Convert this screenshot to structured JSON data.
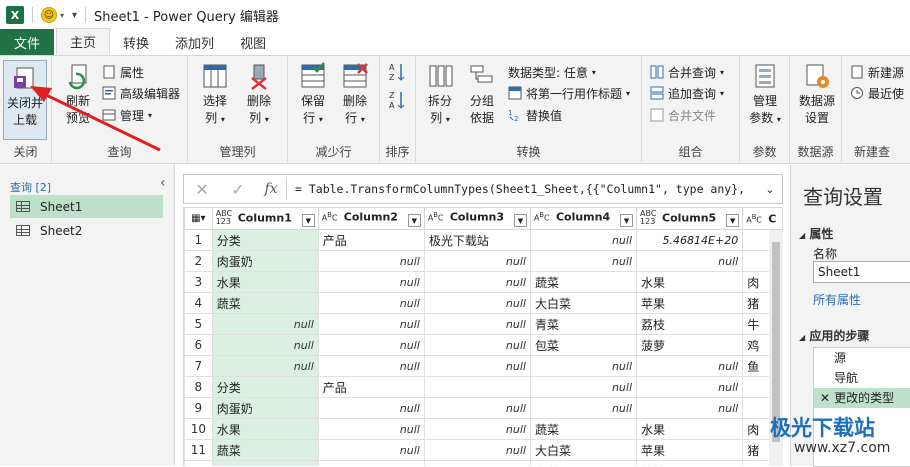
{
  "titlebar": {
    "title": "Sheet1 - Power Query 编辑器",
    "logo": "X"
  },
  "tabs": [
    "文件",
    "主页",
    "转换",
    "添加列",
    "视图"
  ],
  "ribbon": {
    "close": {
      "label1": "关闭并",
      "label2": "上载",
      "group": "关闭"
    },
    "query": {
      "refresh1": "刷新",
      "refresh2": "预览",
      "properties": "属性",
      "advanced": "高级编辑器",
      "manage": "管理",
      "group": "查询"
    },
    "columns": {
      "select1": "选择",
      "select2": "列",
      "delete1": "删除",
      "delete2": "列",
      "group": "管理列"
    },
    "rows": {
      "keep1": "保留",
      "keep2": "行",
      "remove1": "删除",
      "remove2": "行",
      "group": "减少行"
    },
    "sort": {
      "group": "排序"
    },
    "transform": {
      "split1": "拆分",
      "split2": "列",
      "groupby1": "分组",
      "groupby2": "依据",
      "datatype": "数据类型: 任意",
      "firstrow": "将第一行用作标题",
      "replace": "替换值",
      "group": "转换"
    },
    "combine": {
      "merge": "合并查询",
      "append": "追加查询",
      "files": "合并文件",
      "group": "组合"
    },
    "params": {
      "manage1": "管理",
      "manage2": "参数",
      "group": "参数"
    },
    "datasource": {
      "settings1": "数据源",
      "settings2": "设置",
      "group": "数据源"
    },
    "newquery": {
      "newsource": "新建源",
      "recent": "最近使",
      "group": "新建查"
    }
  },
  "queries": {
    "header": "查询 [2]",
    "items": [
      "Sheet1",
      "Sheet2"
    ]
  },
  "formula": {
    "text": "= Table.TransformColumnTypes(Sheet1_Sheet,{{\"Column1\", type any},"
  },
  "columns": [
    {
      "type": "ABC\n123",
      "name": "Column1"
    },
    {
      "type": "ABC",
      "name": "Column2"
    },
    {
      "type": "ABC",
      "name": "Column3"
    },
    {
      "type": "ABC",
      "name": "Column4"
    },
    {
      "type": "ABC\n123",
      "name": "Column5"
    },
    {
      "type": "ABC",
      "name": "C"
    }
  ],
  "rows": [
    [
      "1",
      "分类",
      "产品",
      "极光下载站",
      "null",
      "5.46814E+20",
      ""
    ],
    [
      "2",
      "肉蛋奶",
      "null",
      "null",
      "null",
      "null",
      ""
    ],
    [
      "3",
      "水果",
      "null",
      "null",
      "蔬菜",
      "水果",
      "肉"
    ],
    [
      "4",
      "蔬菜",
      "null",
      "null",
      "大白菜",
      "苹果",
      "猪"
    ],
    [
      "5",
      "null",
      "null",
      "null",
      "青菜",
      "荔枝",
      "牛"
    ],
    [
      "6",
      "null",
      "null",
      "null",
      "包菜",
      "菠萝",
      "鸡"
    ],
    [
      "7",
      "null",
      "null",
      "null",
      "null",
      "null",
      "鱼"
    ],
    [
      "8",
      "分类",
      "产品",
      "",
      "null",
      "null",
      ""
    ],
    [
      "9",
      "肉蛋奶",
      "null",
      "null",
      "null",
      "null",
      ""
    ],
    [
      "10",
      "水果",
      "null",
      "null",
      "蔬菜",
      "水果",
      "肉"
    ],
    [
      "11",
      "蔬菜",
      "null",
      "null",
      "大白菜",
      "苹果",
      "猪"
    ],
    [
      "12",
      "",
      "",
      "",
      "青菜",
      "荔枝",
      ""
    ]
  ],
  "settings": {
    "title": "查询设置",
    "props_header": "属性",
    "name_label": "名称",
    "name_value": "Sheet1",
    "all_props": "所有属性",
    "steps_header": "应用的步骤",
    "steps": [
      "源",
      "导航",
      "更改的类型"
    ]
  },
  "watermark": {
    "line1": "极光下载站",
    "line2": "www.xz7.com"
  }
}
